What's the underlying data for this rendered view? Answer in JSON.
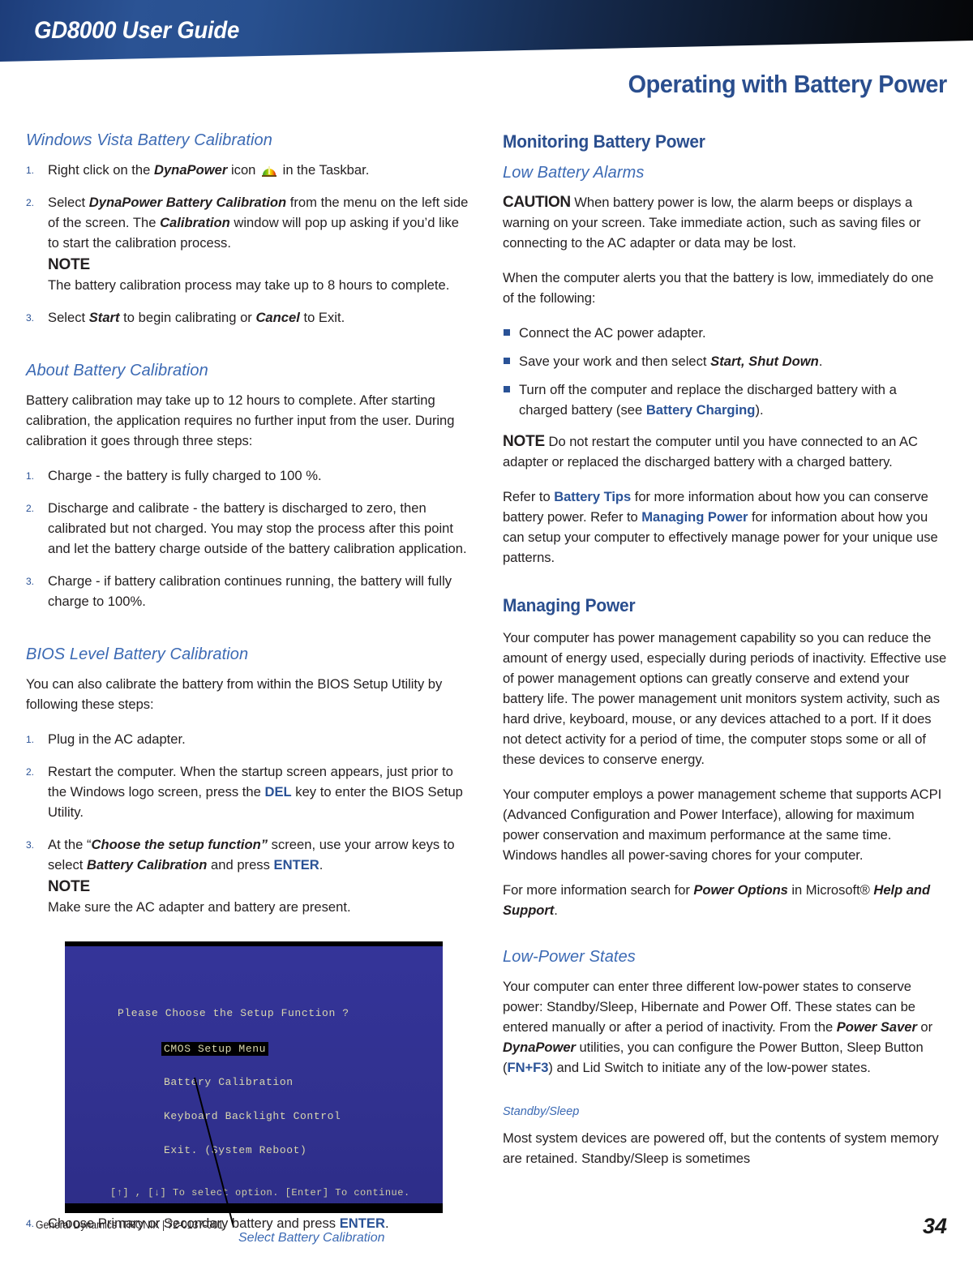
{
  "header": {
    "banner_title": "GD8000 User Guide",
    "page_heading": "Operating with Battery Power",
    "banner_gradient_start": "#1d3d7a",
    "banner_gradient_end": "#050608",
    "heading_color": "#2a4e8e"
  },
  "colors": {
    "heading_blue": "#2a4e8e",
    "subheading_blue": "#3c6ab4",
    "inline_link_blue": "#2a5296",
    "body_text": "#231f20",
    "bios_background": "#2e3192",
    "bios_text": "#d9d7ae"
  },
  "left_column": {
    "subheading_1": "Windows Vista Battery Calibration",
    "vista_steps": [
      {
        "num": "1.",
        "parts": [
          {
            "t": "Right click on the ",
            "s": "normal"
          },
          {
            "t": "DynaPower",
            "s": "bolditalic"
          },
          {
            "t": " icon ",
            "s": "normal"
          },
          {
            "t": "",
            "s": "icon",
            "icon": "dynapower-battery-icon"
          },
          {
            "t": " in the Taskbar.",
            "s": "normal"
          }
        ]
      },
      {
        "num": "2.",
        "parts": [
          {
            "t": "Select ",
            "s": "normal"
          },
          {
            "t": "DynaPower Battery Calibration",
            "s": "bolditalic"
          },
          {
            "t": " from the menu on the left side of the screen. The ",
            "s": "normal"
          },
          {
            "t": "Calibration",
            "s": "bolditalic"
          },
          {
            "t": " window will pop up asking if you’d like to start the calibration process.",
            "s": "normal"
          },
          {
            "t": "NOTE",
            "s": "notelabel"
          },
          {
            "t": " The battery calibration process may take up to 8 hours to complete.",
            "s": "normal"
          }
        ]
      },
      {
        "num": "3.",
        "parts": [
          {
            "t": "Select ",
            "s": "normal"
          },
          {
            "t": "Start",
            "s": "bolditalic"
          },
          {
            "t": " to begin calibrating or ",
            "s": "normal"
          },
          {
            "t": "Cancel",
            "s": "bolditalic"
          },
          {
            "t": " to Exit.",
            "s": "normal"
          }
        ]
      }
    ],
    "subheading_2": "About Battery Calibration",
    "about_paragraph": "Battery calibration may take up to 12 hours to complete.  After starting calibration, the application requires no further input from the user.  During calibration it goes through three steps:",
    "about_steps": [
      {
        "num": "1.",
        "text": "Charge - the battery is fully charged to 100 %."
      },
      {
        "num": "2.",
        "text": "Discharge and calibrate - the battery is discharged to zero, then calibrated but not charged. You may stop the process after this point and let the battery charge outside of the battery calibration application."
      },
      {
        "num": "3.",
        "text": "Charge - if battery calibration continues running, the battery will fully charge to 100%."
      }
    ],
    "subheading_3": "BIOS Level Battery Calibration",
    "bios_intro": "You can also calibrate the battery from within the BIOS Setup Utility by following these steps:",
    "bios_steps": [
      {
        "num": "1.",
        "parts": [
          {
            "t": "Plug in the AC adapter.",
            "s": "normal"
          }
        ]
      },
      {
        "num": "2.",
        "parts": [
          {
            "t": "Restart the computer.  When the startup screen appears, just prior to the Windows logo screen, press the ",
            "s": "normal"
          },
          {
            "t": "DEL",
            "s": "blue"
          },
          {
            "t": " key to enter the BIOS Setup Utility.",
            "s": "normal"
          }
        ]
      },
      {
        "num": "3.",
        "parts": [
          {
            "t": "At the “",
            "s": "normal"
          },
          {
            "t": "Choose the setup function”",
            "s": "bolditalic"
          },
          {
            "t": " screen, use your arrow keys to select ",
            "s": "normal"
          },
          {
            "t": "Battery Calibration",
            "s": "bolditalic"
          },
          {
            "t": " and press ",
            "s": "normal"
          },
          {
            "t": "ENTER",
            "s": "blue"
          },
          {
            "t": ".",
            "s": "normal"
          },
          {
            "t": "NOTE",
            "s": "notelabel"
          },
          {
            "t": " Make sure the AC adapter and battery are present.",
            "s": "normal"
          }
        ]
      }
    ],
    "bios_screen": {
      "prompt": "Please Choose the Setup Function ?",
      "options": [
        {
          "label": "CMOS Setup Menu",
          "selected": true
        },
        {
          "label": "Battery Calibration",
          "selected": false
        },
        {
          "label": "Keyboard Backlight Control",
          "selected": false
        },
        {
          "label": "Exit. (System Reboot)",
          "selected": false
        }
      ],
      "footer_hint": "[↑] , [↓]  To select option.  [Enter] To continue.",
      "caption": "Select Battery Calibration"
    },
    "final_step": {
      "num": "4.",
      "parts": [
        {
          "t": "Choose Primary or Secondary battery and press ",
          "s": "normal"
        },
        {
          "t": "ENTER",
          "s": "blue"
        },
        {
          "t": ".",
          "s": "normal"
        }
      ]
    }
  },
  "right_column": {
    "heading_1": "Monitoring Battery Power",
    "subheading_1": "Low Battery Alarms",
    "caution": {
      "label": "CAUTION",
      "text": " When battery power is low, the alarm beeps or displays a warning on your screen. Take immediate action, such as saving files or connecting to the AC adapter or data may be lost."
    },
    "alerts_intro": "When the computer alerts you that the battery is low, immediately do one of the following:",
    "alert_bullets": [
      {
        "parts": [
          {
            "t": "Connect the AC power adapter.",
            "s": "normal"
          }
        ]
      },
      {
        "parts": [
          {
            "t": "Save your work and then select ",
            "s": "normal"
          },
          {
            "t": "Start, Shut Down",
            "s": "bolditalic"
          },
          {
            "t": ".",
            "s": "normal"
          }
        ]
      },
      {
        "parts": [
          {
            "t": "Turn off the computer and replace the discharged battery with a charged battery (see ",
            "s": "normal"
          },
          {
            "t": "Battery Charging",
            "s": "blue"
          },
          {
            "t": ").",
            "s": "normal"
          }
        ]
      }
    ],
    "note_restart": {
      "label": "NOTE",
      "text": "  Do not restart the computer until you have connected to an AC adapter or replaced the discharged battery with a charged battery."
    },
    "refer_paragraph": [
      {
        "t": "Refer to ",
        "s": "normal"
      },
      {
        "t": "Battery Tips",
        "s": "blue"
      },
      {
        "t": " for more information about how you can conserve battery power.  Refer to ",
        "s": "normal"
      },
      {
        "t": "Managing Power",
        "s": "blue"
      },
      {
        "t": " for information about how you can setup your computer to effectively manage power for your unique use patterns.",
        "s": "normal"
      }
    ],
    "heading_2": "Managing Power",
    "managing_para_1": "Your computer has power management capability so you can reduce the amount of energy used, especially during periods of inactivity.  Effective use of power management options can greatly conserve and extend your battery life.  The power management unit monitors system activity, such as hard drive, keyboard, mouse, or any devices attached to a port.  If it does not detect activity for a period of time, the computer stops some or all of these devices to conserve energy.",
    "managing_para_2": "Your computer employs a power management scheme that supports ACPI (Advanced Configuration and Power Interface), allowing for maximum power conservation and maximum performance at the same time. Windows handles all power-saving chores for your computer.",
    "power_options_para": [
      {
        "t": "For more information search for ",
        "s": "normal"
      },
      {
        "t": "Power Options",
        "s": "bolditalic"
      },
      {
        "t": " in Microsoft® ",
        "s": "normal"
      },
      {
        "t": "Help and Support",
        "s": "bolditalic"
      },
      {
        "t": ".",
        "s": "normal"
      }
    ],
    "subheading_2": "Low-Power States",
    "low_power_para": [
      {
        "t": "Your computer can enter three different low-power states to conserve power: Standby/Sleep, Hibernate and Power Off. These states can be entered manually or after a period of inactivity.  From the ",
        "s": "normal"
      },
      {
        "t": "Power Saver",
        "s": "bolditalic"
      },
      {
        "t": " or ",
        "s": "normal"
      },
      {
        "t": "DynaPower",
        "s": "bolditalic"
      },
      {
        "t": " utilities, you can configure the Power Button, Sleep Button (",
        "s": "normal"
      },
      {
        "t": "FN+F3",
        "s": "blue"
      },
      {
        "t": ") and Lid Switch to initiate any of the low-power states.",
        "s": "normal"
      }
    ],
    "subheading_3": "Standby/Sleep",
    "standby_para": "Most system devices are powered off, but the contents of system memory are retained.  Standby/Sleep is sometimes"
  },
  "footer": {
    "left": "General Dynamics ITRONIX | 72-0137-001",
    "page_number": "34"
  }
}
